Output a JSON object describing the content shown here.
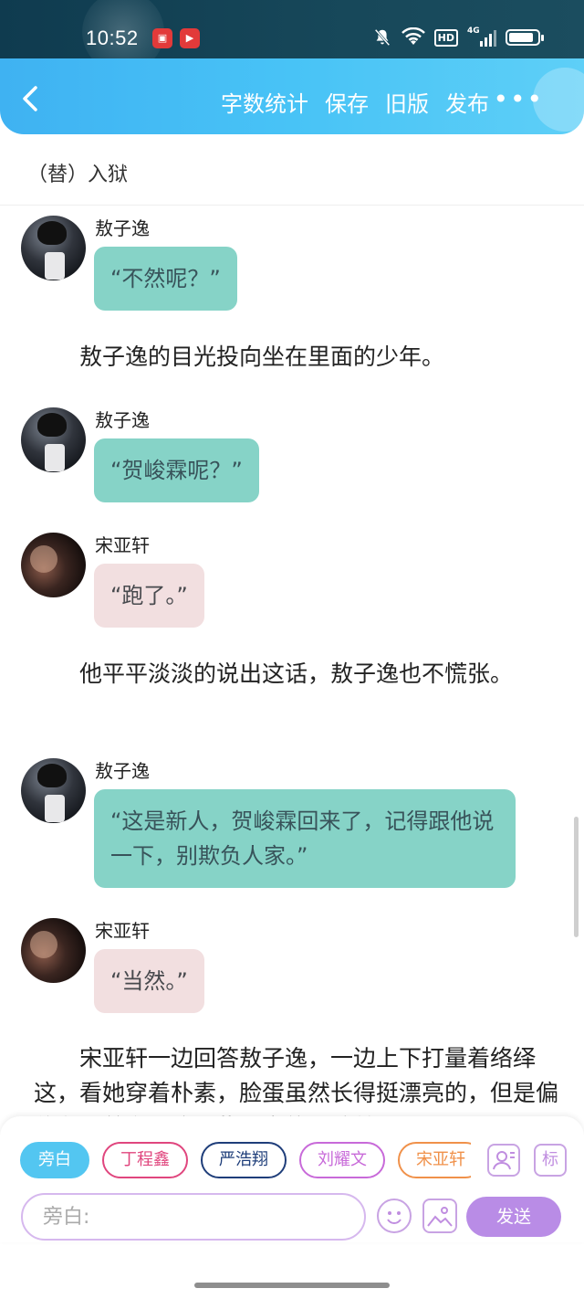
{
  "status_bar": {
    "time": "10:52",
    "network": "4G",
    "hd": "HD",
    "battery_level": 0.85
  },
  "toolbar": {
    "actions": [
      "字数统计",
      "保存",
      "旧版",
      "发布"
    ],
    "more": "•••"
  },
  "chapter": {
    "title": "（替）入狱"
  },
  "content": {
    "messages": [
      {
        "type": "dialog",
        "speaker": "敖子逸",
        "text": "“不然呢？”",
        "style": "green"
      },
      {
        "type": "narration",
        "text": "敖子逸的目光投向坐在里面的少年。"
      },
      {
        "type": "dialog",
        "speaker": "敖子逸",
        "text": "“贺峻霖呢？”",
        "style": "green"
      },
      {
        "type": "dialog",
        "speaker": "宋亚轩",
        "text": "“跑了。”",
        "style": "pink"
      },
      {
        "type": "narration",
        "text": "他平平淡淡的说出这话，敖子逸也不慌张。"
      },
      {
        "type": "dialog",
        "speaker": "敖子逸",
        "text": "“这是新人，贺峻霖回来了，记得跟他说一下，别欺负人家。”",
        "style": "green"
      },
      {
        "type": "dialog",
        "speaker": "宋亚轩",
        "text": "“当然。”",
        "style": "pink"
      },
      {
        "type": "narration",
        "text": "宋亚轩一边回答敖子逸，一边上下打量着络绎这，看她穿着朴素，脸蛋虽然长得挺漂亮的，但是偏偏有了着侮辱这那些漂亮的小脸并"
      }
    ]
  },
  "bottom_panel": {
    "roles": [
      {
        "label": "旁白",
        "active": true,
        "color": "#53c6f1"
      },
      {
        "label": "丁程鑫",
        "active": false,
        "color": "#e0467e"
      },
      {
        "label": "严浩翔",
        "active": false,
        "color": "#1f3e7a"
      },
      {
        "label": "刘耀文",
        "active": false,
        "color": "#c86ad9"
      },
      {
        "label": "宋亚轩",
        "active": false,
        "color": "#f0914a"
      }
    ],
    "tag_label": "标",
    "input_placeholder": "旁白:",
    "send_label": "发送"
  }
}
